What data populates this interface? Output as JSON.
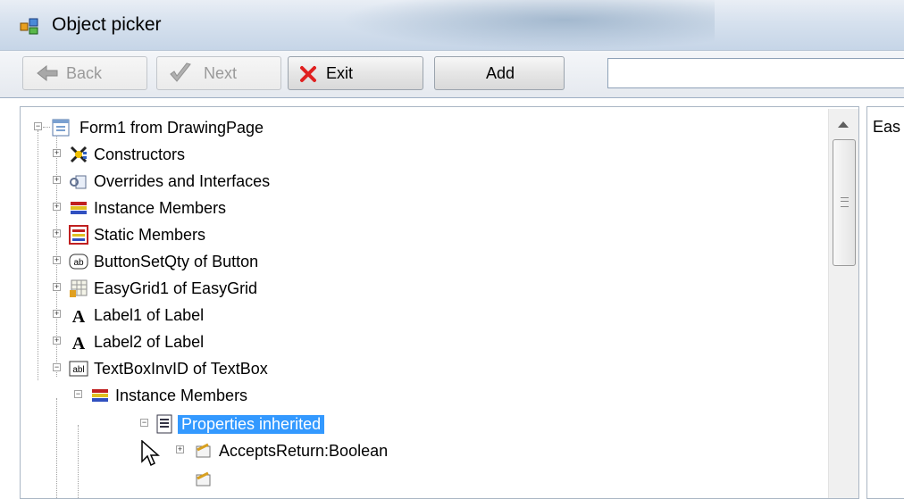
{
  "window": {
    "title": "Object picker"
  },
  "toolbar": {
    "back_label": "Back",
    "next_label": "Next",
    "exit_label": "Exit",
    "add_label": "Add",
    "search_value": ""
  },
  "tree": {
    "items": [
      {
        "label": "Form1 from DrawingPage",
        "icon": "form-icon",
        "expanded": true
      },
      {
        "label": "Constructors",
        "icon": "constructors-icon",
        "expanded": false
      },
      {
        "label": "Overrides and Interfaces",
        "icon": "interfaces-icon",
        "expanded": false
      },
      {
        "label": "Instance Members",
        "icon": "members-icon",
        "expanded": false
      },
      {
        "label": "Static Members",
        "icon": "static-members-icon",
        "expanded": false
      },
      {
        "label": "ButtonSetQty of Button",
        "icon": "button-control-icon",
        "expanded": false
      },
      {
        "label": "EasyGrid1 of EasyGrid",
        "icon": "grid-icon",
        "expanded": false
      },
      {
        "label": "Label1 of Label",
        "icon": "label-icon",
        "expanded": false
      },
      {
        "label": "Label2 of Label",
        "icon": "label-icon",
        "expanded": false
      },
      {
        "label": "TextBoxInvID of TextBox",
        "icon": "textbox-icon",
        "expanded": true
      },
      {
        "label": "Instance Members",
        "icon": "members-icon",
        "expanded": true
      },
      {
        "label": "Properties inherited",
        "icon": "properties-icon",
        "expanded": true,
        "selected": true
      },
      {
        "label": "AcceptsReturn:Boolean",
        "icon": "property-icon",
        "expanded": false
      }
    ]
  },
  "right_panel": {
    "text": "Eas"
  },
  "colors": {
    "selection": "#3399ff",
    "titlebar": "#d6e1ee"
  }
}
